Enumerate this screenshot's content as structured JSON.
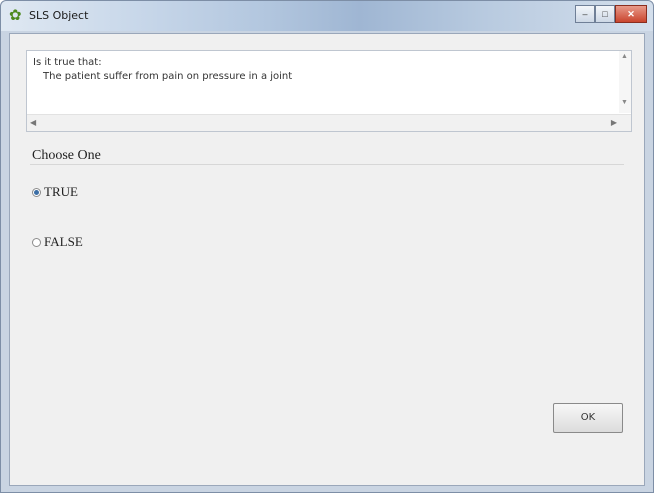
{
  "window": {
    "title": "SLS Object",
    "icon": "leaf-app-icon",
    "controls": {
      "minimize": "–",
      "maximize": "□",
      "close": "✕"
    }
  },
  "question": {
    "prompt": "Is it true that:",
    "statement": "The patient suffer from pain on pressure in a joint"
  },
  "choices": {
    "label": "Choose One",
    "options": [
      {
        "label": "TRUE",
        "selected": true
      },
      {
        "label": "FALSE",
        "selected": false
      }
    ]
  },
  "actions": {
    "ok_label": "OK"
  },
  "colors": {
    "accent": "#3b6ea5",
    "client_bg": "#f0f0f0"
  }
}
